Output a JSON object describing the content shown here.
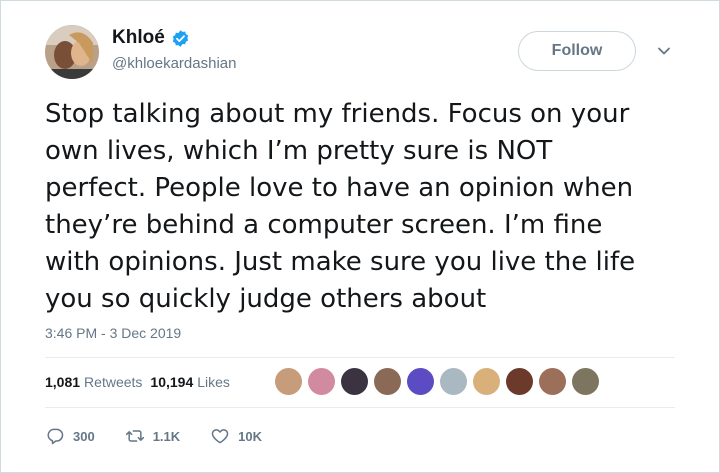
{
  "header": {
    "display_name": "Khloé",
    "handle": "@khloekardashian",
    "follow_label": "Follow",
    "avatar_icon": "profile-photo-avatar",
    "verified_icon": "verified-badge-icon",
    "caret_icon": "chevron-down-icon"
  },
  "tweet": {
    "lines": [
      "Stop talking about my friends. Focus on your",
      "own lives, which I’m pretty sure is NOT",
      "perfect. People love to have an opinion when",
      "they’re behind a computer screen. I’m fine",
      "with opinions. Just make sure you live the life",
      "you so quickly judge others about"
    ],
    "timestamp": "3:46 PM - 3 Dec 2019"
  },
  "stats": {
    "retweets_count": "1,081",
    "retweets_label": "Retweets",
    "likes_count": "10,194",
    "likes_label": "Likes",
    "liker_avatar_count": 10
  },
  "actions": {
    "reply_count": "300",
    "retweet_count": "1.1K",
    "like_count": "10K",
    "reply_icon": "reply-icon",
    "retweet_icon": "retweet-icon",
    "like_icon": "heart-icon"
  },
  "colors": {
    "primary_text": "#14171a",
    "secondary_text": "#657786",
    "verified_blue": "#1da1f2",
    "divider": "#e6ecf0"
  }
}
